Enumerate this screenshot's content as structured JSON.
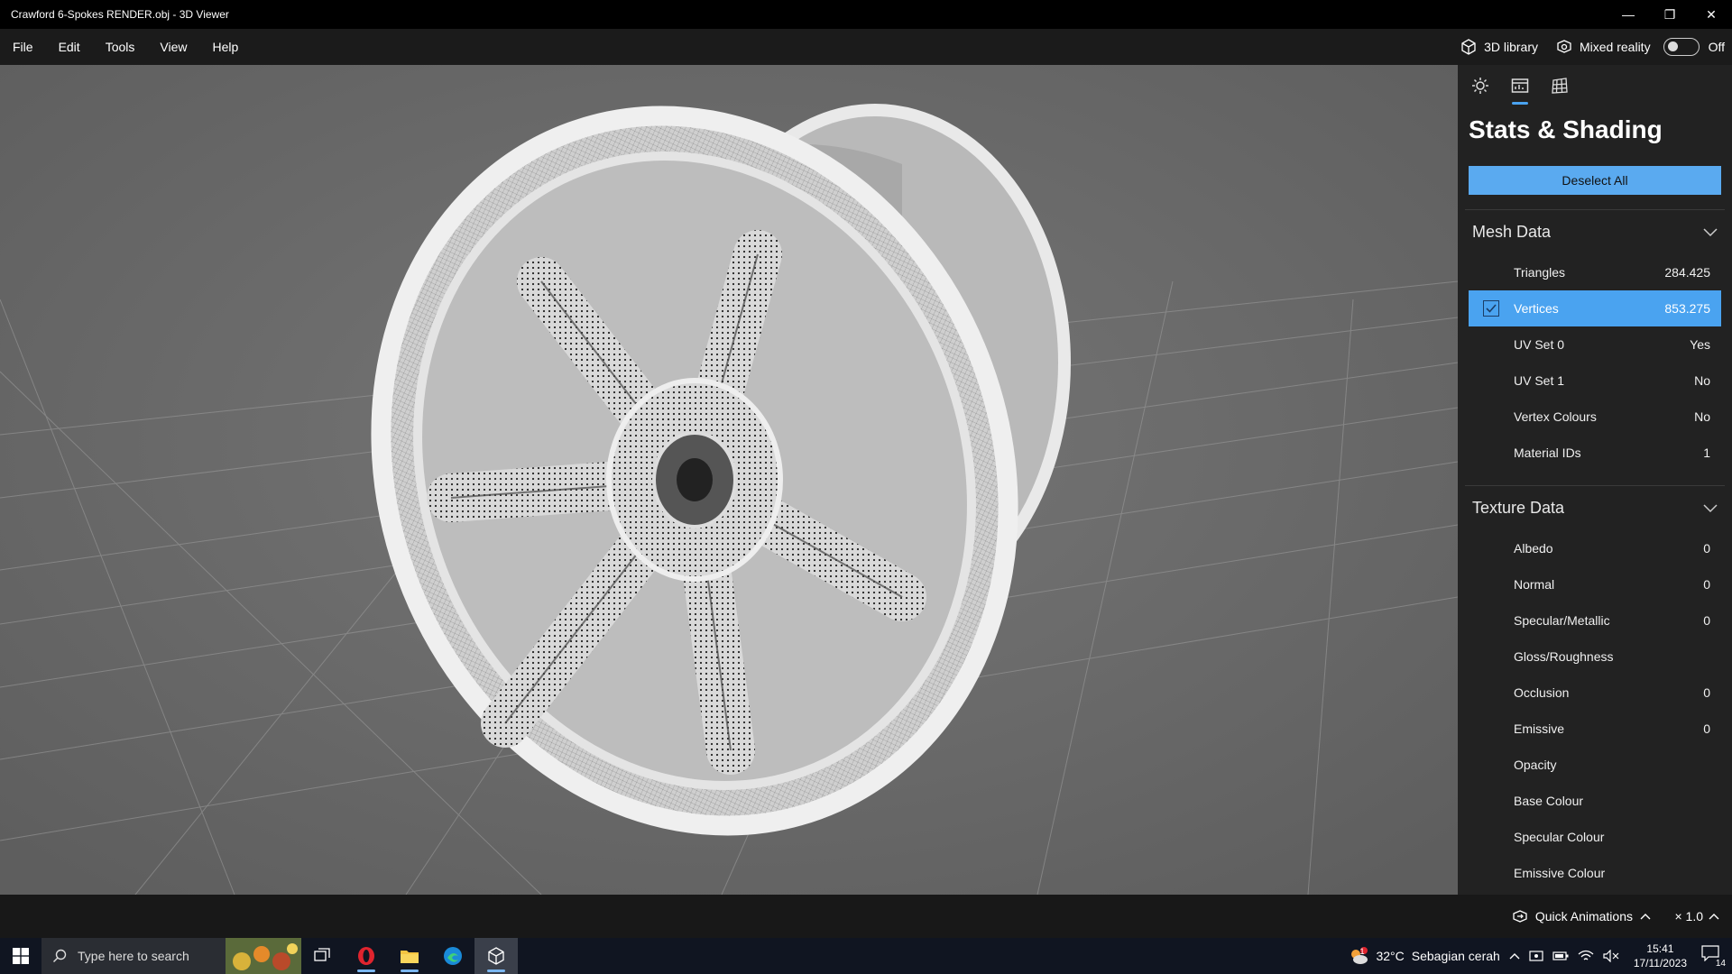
{
  "window": {
    "title": "Crawford 6-Spokes RENDER.obj - 3D Viewer",
    "minimize": "—",
    "maximize": "❐",
    "close": "✕"
  },
  "menu": {
    "items": [
      "File",
      "Edit",
      "Tools",
      "View",
      "Help"
    ],
    "library_label": "3D library",
    "mixed_reality_label": "Mixed reality",
    "mixed_reality_state": "Off"
  },
  "panel": {
    "title": "Stats & Shading",
    "deselect_label": "Deselect All",
    "mesh_section": "Mesh Data",
    "mesh_rows": [
      {
        "label": "Triangles",
        "value": "284.425",
        "checked": false
      },
      {
        "label": "Vertices",
        "value": "853.275",
        "checked": true
      },
      {
        "label": "UV Set 0",
        "value": "Yes",
        "checked": false
      },
      {
        "label": "UV Set 1",
        "value": "No",
        "checked": false
      },
      {
        "label": "Vertex Colours",
        "value": "No",
        "checked": false
      },
      {
        "label": "Material IDs",
        "value": "1",
        "checked": false
      }
    ],
    "texture_section": "Texture Data",
    "texture_rows": [
      {
        "label": "Albedo",
        "value": "0"
      },
      {
        "label": "Normal",
        "value": "0"
      },
      {
        "label": "Specular/Metallic",
        "value": "0"
      },
      {
        "label": "Gloss/Roughness",
        "value": ""
      },
      {
        "label": "Occlusion",
        "value": "0"
      },
      {
        "label": "Emissive",
        "value": "0"
      },
      {
        "label": "Opacity",
        "value": ""
      },
      {
        "label": "Base Colour",
        "value": ""
      },
      {
        "label": "Specular Colour",
        "value": ""
      },
      {
        "label": "Emissive Colour",
        "value": ""
      }
    ]
  },
  "statusbar": {
    "quick_animations": "Quick Animations",
    "speed": "× 1.0"
  },
  "taskbar": {
    "search_placeholder": "Type here to search",
    "weather_temp": "32°C",
    "weather_desc": "Sebagian cerah",
    "weather_badge": "1",
    "time": "15:41",
    "date": "17/11/2023",
    "notification_count": "14"
  },
  "colors": {
    "accent": "#4aa3f0",
    "panel_bg": "#222222",
    "viewport_bg": "#6b6b6b"
  }
}
